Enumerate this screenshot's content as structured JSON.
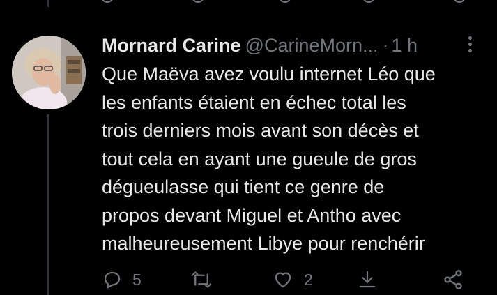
{
  "tweet": {
    "display_name": "Mornard Carine",
    "handle": "@CarineMorn...",
    "separator": "·",
    "timestamp": "1 h",
    "text": "Que Maëva avez voulu internet Léo que\nles enfants étaient en échec total les\ntrois derniers mois avant son décès et\ntout cela en ayant une gueule de gros\ndégueulasse qui tient ce genre de\npropos devant Miguel et Antho avec\nmalheureusement Libye pour renchérir",
    "reply_count": "5",
    "retweet_count": "",
    "like_count": "2"
  },
  "icons": {
    "more": "more-vertical-icon",
    "reply": "reply-icon",
    "retweet": "retweet-icon",
    "like": "heart-icon",
    "bookmark": "bookmark-down-icon",
    "share": "share-icon"
  },
  "colors": {
    "background": "#000000",
    "primary_text": "#e7e9ea",
    "secondary_text": "#71767b",
    "thread_line": "#333639"
  }
}
